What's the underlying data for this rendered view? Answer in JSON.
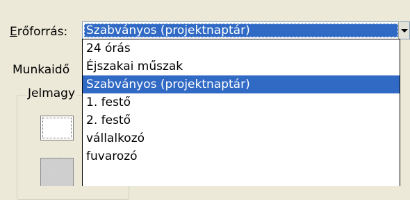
{
  "resource": {
    "label_mnemonic": "E",
    "label_rest": "rőforrás:",
    "selected_value": "Szabványos (projektnaptár)"
  },
  "background": {
    "worktime_label": "Munkaidő",
    "legend_label": "Jelmagy"
  },
  "dropdown": {
    "items": [
      "24 órás",
      "Éjszakai műszak",
      "Szabványos (projektnaptár)",
      "1. festő",
      "2. festő",
      "vállalkozó",
      "fuvarozó"
    ],
    "selected_index": 2
  },
  "colors": {
    "highlight": "#316ac5",
    "dialog_bg": "#ece9d8"
  }
}
